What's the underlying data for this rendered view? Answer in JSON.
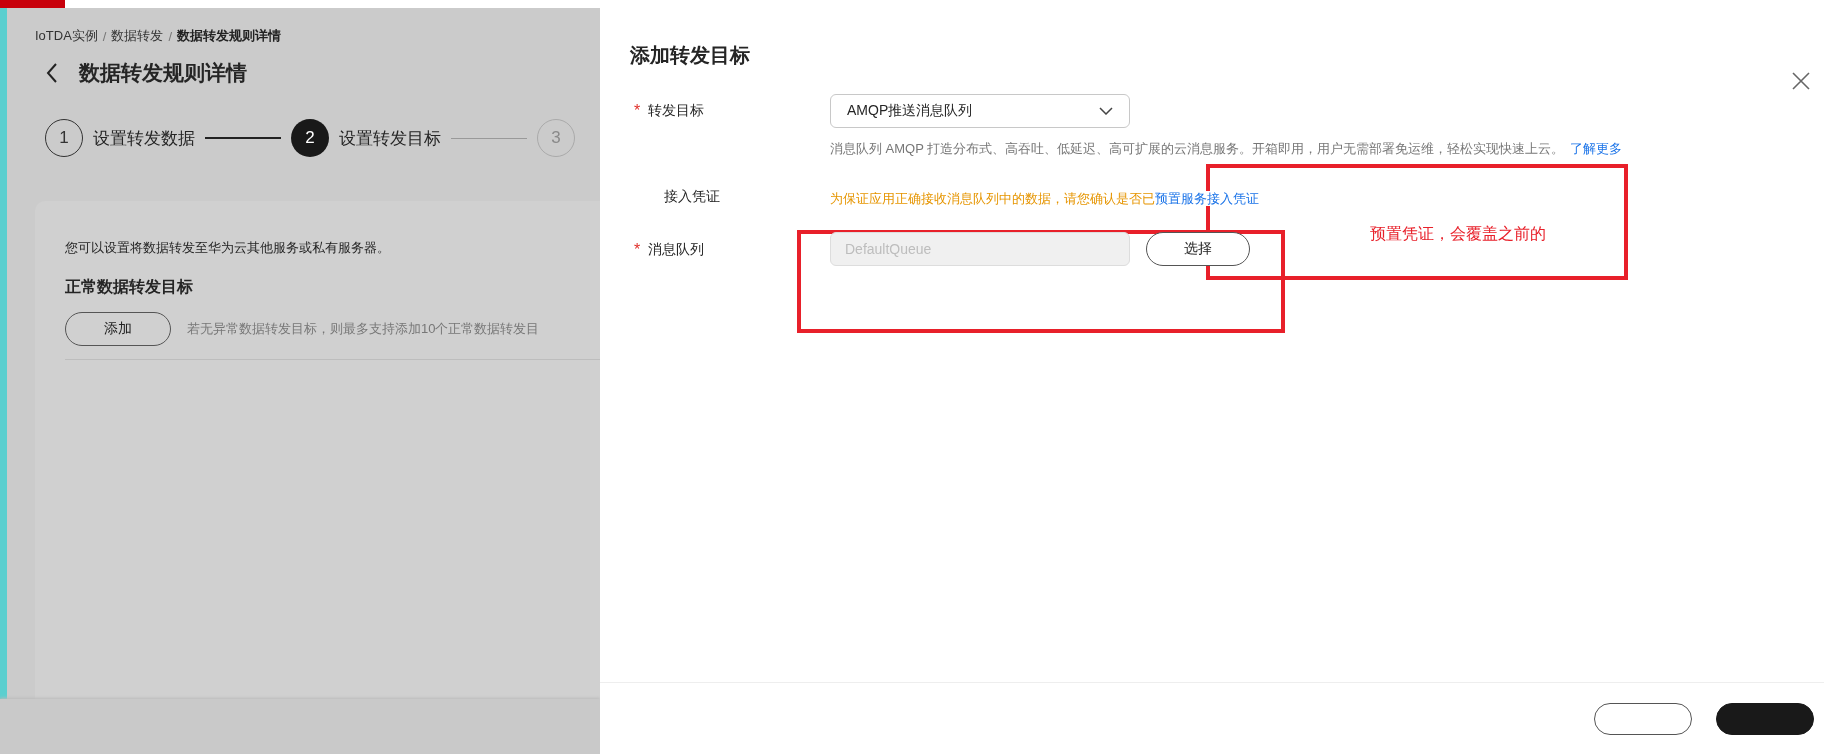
{
  "breadcrumb": [
    {
      "kind": "link",
      "label": "IoTDA实例"
    },
    {
      "kind": "separator",
      "label": "/"
    },
    {
      "kind": "link",
      "label": "数据转发"
    },
    {
      "kind": "separator",
      "label": "/"
    },
    {
      "kind": "current",
      "label": "数据转发规则详情"
    }
  ],
  "page_title": "数据转发规则详情",
  "steps": [
    {
      "number": "1",
      "label": "设置转发数据",
      "done": true,
      "selected": false
    },
    {
      "number": "2",
      "label": "设置转发目标",
      "done": false,
      "selected": true
    },
    {
      "number": "3",
      "done": false,
      "selected": false
    }
  ],
  "card": {
    "intro": "您可以设置将数据转发至华为云其他服务或私有服务器。",
    "heading": "正常数据转发目标",
    "add_button": "添加",
    "hint": "若无异常数据转发目标，则最多支持添加10个正常数据转发目"
  },
  "drawer": {
    "title": "添加转发目标",
    "fields": [
      {
        "kind": "select",
        "label": "转发目标",
        "required_mark": "*",
        "value": "AMQP推送消息队列",
        "description": "消息队列 AMQP 打造分布式、高吞吐、低延迟、高可扩展的云消息服务。开箱即用，用户无需部署免运维，轻松实现快速上云。",
        "link": "了解更多"
      },
      {
        "kind": "notice",
        "label": "接入凭证",
        "text": "为保证应用正确接收消息队列中的数据，请您确认是否已",
        "link": "预置服务接入凭证"
      },
      {
        "kind": "picker",
        "label": "消息队列",
        "required_mark": "*",
        "value": "DefaultQueue",
        "disabled": true,
        "button": "选择"
      }
    ],
    "annotation": "预置凭证，会覆盖之前的",
    "footer_buttons": [
      {
        "kind": "outline"
      },
      {
        "kind": "primary"
      }
    ]
  }
}
